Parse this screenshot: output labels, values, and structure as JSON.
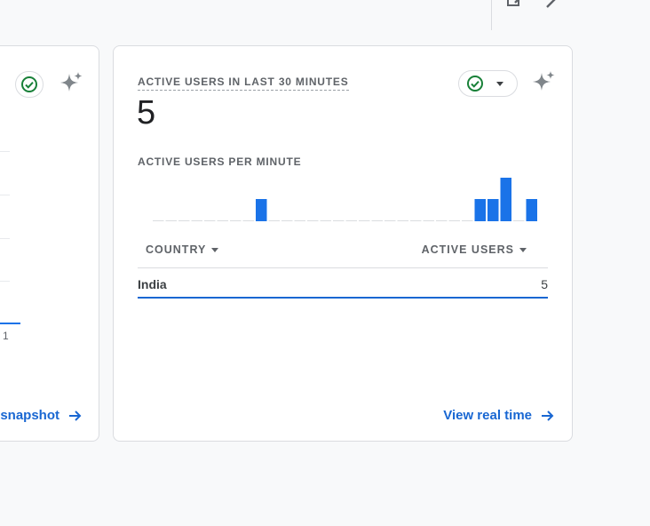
{
  "colors": {
    "accent": "#1a73e8",
    "link": "#1967d2",
    "check": "#188038",
    "muted": "#5f6368"
  },
  "toolbar": {
    "icons": [
      "edit-icon",
      "wand-icon"
    ]
  },
  "left_card": {
    "axis_tick": "1",
    "link_label": "snapshot"
  },
  "realtime_card": {
    "metric_label": "ACTIVE USERS IN LAST 30 MINUTES",
    "metric_value": "5",
    "chart_label": "ACTIVE USERS PER MINUTE",
    "table": {
      "columns": [
        "COUNTRY",
        "ACTIVE USERS"
      ],
      "rows": [
        {
          "country": "India",
          "active_users": "5"
        }
      ]
    },
    "link_label": "View real time"
  },
  "chart_data": {
    "type": "bar",
    "title": "ACTIVE USERS PER MINUTE",
    "x": [
      "-30",
      "-29",
      "-28",
      "-27",
      "-26",
      "-25",
      "-24",
      "-23",
      "-22",
      "-21",
      "-20",
      "-19",
      "-18",
      "-17",
      "-16",
      "-15",
      "-14",
      "-13",
      "-12",
      "-11",
      "-10",
      "-9",
      "-8",
      "-7",
      "-6",
      "-5",
      "-4",
      "-3",
      "-2",
      "-1"
    ],
    "values": [
      0,
      0,
      0,
      0,
      0,
      0,
      0,
      0,
      1,
      0,
      0,
      0,
      0,
      0,
      0,
      0,
      0,
      0,
      0,
      0,
      0,
      0,
      0,
      0,
      0,
      1,
      1,
      2,
      0,
      1
    ],
    "ylim": [
      0,
      2
    ]
  }
}
